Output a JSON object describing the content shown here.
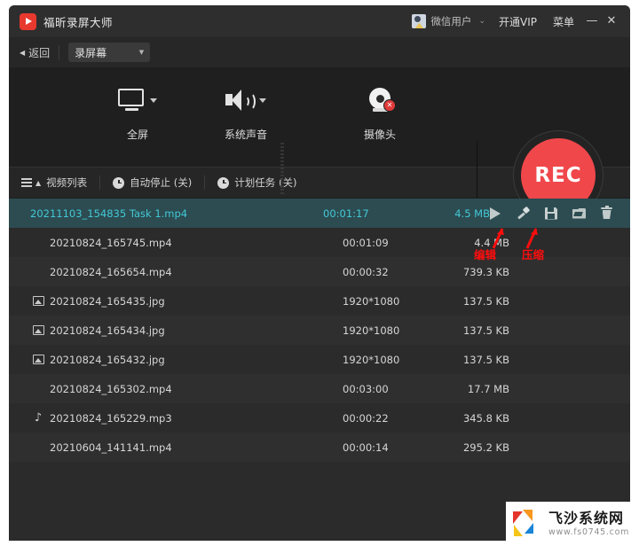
{
  "titlebar": {
    "app_title": "福昕录屏大师",
    "logo_icon": "play-logo-icon",
    "user_name": "微信用户",
    "user_caret": "⌄",
    "vip_label": "开通VIP",
    "menu_label": "菜单",
    "minimize_label": "—",
    "close_label": "✕"
  },
  "moderow": {
    "back_arrow": "◀",
    "back_label": "返回",
    "mode_value": "录屏幕",
    "mode_caret": "▼"
  },
  "capture": {
    "options": [
      {
        "icon": "monitor-icon",
        "label": "全屏",
        "has_dropdown": true
      },
      {
        "icon": "speaker-icon",
        "label": "系统声音",
        "has_dropdown": true
      },
      {
        "icon": "webcam-icon",
        "label": "摄像头",
        "has_dropdown": false,
        "badge": "✕"
      }
    ],
    "record_button_label": "REC",
    "record_button_color": "#f0474b"
  },
  "listbar": {
    "items": [
      {
        "icon": "list-icon",
        "label": "视频列表"
      },
      {
        "icon": "clock-icon",
        "label": "自动停止 (关)"
      },
      {
        "icon": "clock-icon",
        "label": "计划任务 (关)"
      }
    ]
  },
  "files": {
    "rows": [
      {
        "icon": "",
        "name": "20211103_154835 Task 1.mp4",
        "duration": "00:01:17",
        "size": "4.5 MB",
        "selected": true
      },
      {
        "icon": "",
        "name": "20210824_165745.mp4",
        "duration": "00:01:09",
        "size": "4.4 MB",
        "selected": false
      },
      {
        "icon": "",
        "name": "20210824_165654.mp4",
        "duration": "00:00:32",
        "size": "739.3 KB",
        "selected": false
      },
      {
        "icon": "image-icon",
        "name": "20210824_165435.jpg",
        "duration": "1920*1080",
        "size": "137.5 KB",
        "selected": false
      },
      {
        "icon": "image-icon",
        "name": "20210824_165434.jpg",
        "duration": "1920*1080",
        "size": "137.5 KB",
        "selected": false
      },
      {
        "icon": "image-icon",
        "name": "20210824_165432.jpg",
        "duration": "1920*1080",
        "size": "137.5 KB",
        "selected": false
      },
      {
        "icon": "",
        "name": "20210824_165302.mp4",
        "duration": "00:03:00",
        "size": "17.7 MB",
        "selected": false
      },
      {
        "icon": "music-icon",
        "name": "20210824_165229.mp3",
        "duration": "00:00:22",
        "size": "345.8 KB",
        "selected": false
      },
      {
        "icon": "",
        "name": "20210604_141141.mp4",
        "duration": "00:00:14",
        "size": "295.2 KB",
        "selected": false
      }
    ],
    "row_actions": [
      {
        "icon": "play-icon",
        "name": "play-action"
      },
      {
        "icon": "brush-icon",
        "name": "edit-action"
      },
      {
        "icon": "disk-icon",
        "name": "compress-action"
      },
      {
        "icon": "folder-icon",
        "name": "open-folder-action"
      },
      {
        "icon": "trash-icon",
        "name": "delete-action"
      }
    ],
    "selected_row_bg": "#2c4c51",
    "selected_row_fg": "#43c8d6"
  },
  "annotations": {
    "color": "#ff0d0d",
    "items": [
      {
        "label": "编辑",
        "target": "edit-action"
      },
      {
        "label": "压缩",
        "target": "compress-action"
      }
    ]
  },
  "watermark": {
    "name": "飞沙系统网",
    "url": "www.fs0745.com"
  }
}
